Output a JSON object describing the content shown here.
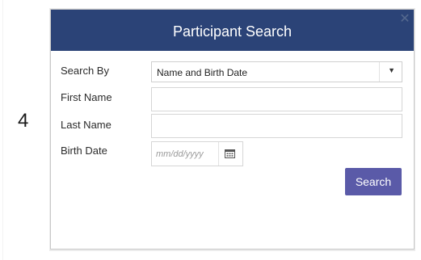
{
  "step_number": "4",
  "dialog": {
    "title": "Participant Search",
    "close_icon": "close-icon"
  },
  "form": {
    "search_by": {
      "label": "Search By",
      "selected": "Name and Birth Date"
    },
    "first_name": {
      "label": "First Name",
      "value": ""
    },
    "last_name": {
      "label": "Last Name",
      "value": ""
    },
    "birth_date": {
      "label": "Birth Date",
      "placeholder": "mm/dd/yyyy",
      "icon": "calendar-icon"
    },
    "search_button_label": "Search"
  },
  "colors": {
    "header": "#2b4377",
    "button": "#5a5aa8"
  }
}
